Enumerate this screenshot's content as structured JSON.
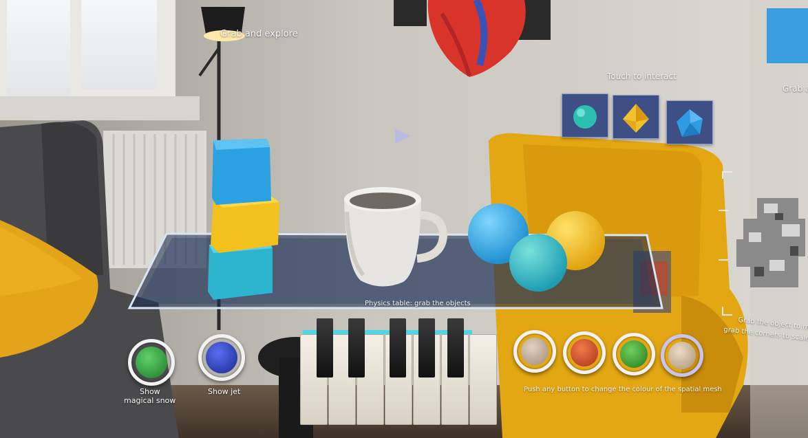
{
  "labels": {
    "grab_explore": "Grab and explore",
    "touch_interact": "Touch to interact",
    "grab_partial": "Grab a",
    "physics_table": "Physics table: grab the objects",
    "grab_object_line1": "Grab the object to mo",
    "grab_object_line2": "grab the corners to scale a",
    "mesh_instruction": "Push any button to change the colour of the spatial mesh"
  },
  "buttons": {
    "snow_line1": "Show",
    "snow_line2": "magical snow",
    "jet": "Show jet"
  },
  "colors": {
    "snow_button": "#2f9a3a",
    "jet_button": "#2438b8",
    "mesh_beige": "#c8b4a2",
    "mesh_orange": "#d6512c",
    "mesh_green": "#3f9f3a",
    "mesh_lavender": "#d3bfa7",
    "tile_bg": "#3e4f86",
    "table_rim": "#d9e4f4"
  },
  "icons": {
    "tile1": "sphere-icon",
    "tile2": "octahedron-icon",
    "tile3": "icosahedron-icon"
  }
}
